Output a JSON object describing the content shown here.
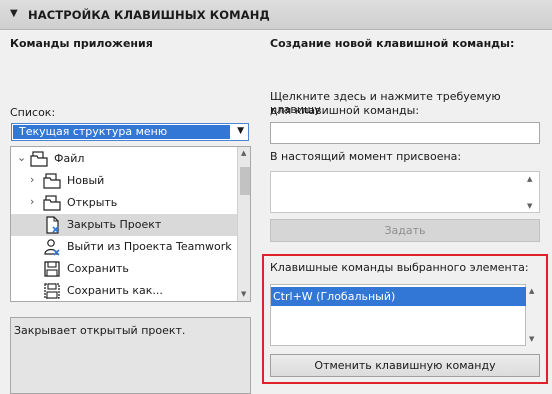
{
  "panel": {
    "title": "НАСТРОЙКА КЛАВИШНЫХ КОМАНД",
    "collapse_icon": "triangle-down-icon"
  },
  "left": {
    "heading": "Команды приложения",
    "list_label": "Список:",
    "select_value": "Текущая структура меню",
    "tree": [
      {
        "label": "Файл",
        "icon": "folder-icon",
        "expanded": true
      },
      {
        "label": "Новый",
        "icon": "folder-icon",
        "expanded": false
      },
      {
        "label": "Открыть",
        "icon": "folder-icon",
        "expanded": false
      },
      {
        "label": "Закрыть Проект",
        "icon": "close-document-icon",
        "selected": true
      },
      {
        "label": "Выйти из Проекта Teamwork",
        "icon": "teamwork-user-icon"
      },
      {
        "label": "Сохранить",
        "icon": "save-icon"
      },
      {
        "label": "Сохранить как...",
        "icon": "save-as-icon"
      }
    ],
    "description": "Закрывает открытый проект."
  },
  "right": {
    "heading": "Создание новой клавишной команды:",
    "instruction_line1": "Щелкните здесь и нажмите требуемую клавишу",
    "instruction_line2": "для клавишной команды:",
    "key_input_value": "",
    "assigned_label": "В настоящий момент присвоена:",
    "assign_button": "Задать",
    "shortcuts_label": "Клавишные команды выбранного элемента:",
    "shortcuts": [
      "Ctrl+W (Глобальный)"
    ],
    "cancel_button": "Отменить клавишную команду"
  },
  "colors": {
    "selection": "#3377d6",
    "highlight_border": "#e0202a",
    "header_bg": "#d6d6d6"
  }
}
